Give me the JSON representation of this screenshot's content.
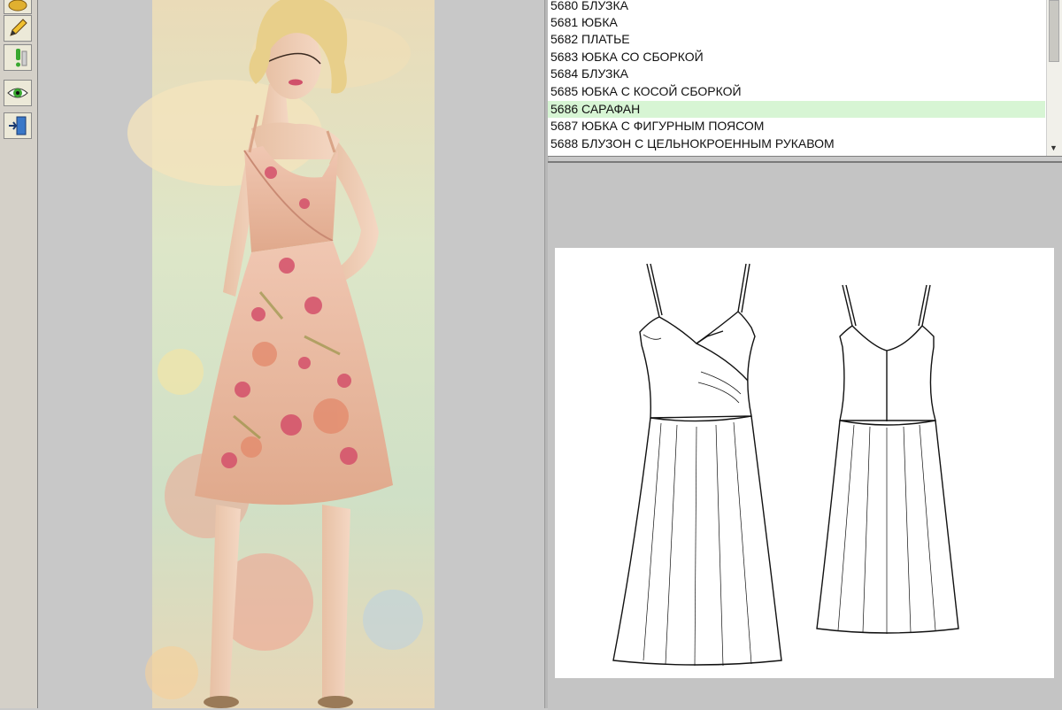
{
  "toolbar": {
    "buttons": [
      "open-icon",
      "pencil-icon",
      "info-icon",
      "eye-icon",
      "exit-icon"
    ]
  },
  "model_list": {
    "items": [
      {
        "label": "5680 БЛУЗКА",
        "selected": false
      },
      {
        "label": "5681 ЮБКА",
        "selected": false
      },
      {
        "label": "5682 ПЛАТЬЕ",
        "selected": false
      },
      {
        "label": "5683 ЮБКА СО СБОРКОЙ",
        "selected": false
      },
      {
        "label": "5684 БЛУЗКА",
        "selected": false
      },
      {
        "label": "5685 ЮБКА С КОСОЙ СБОРКОЙ",
        "selected": false
      },
      {
        "label": "5686 САРАФАН",
        "selected": true
      },
      {
        "label": "5687 ЮБКА С ФИГУРНЫМ ПОЯСОМ",
        "selected": false
      },
      {
        "label": "5688 БЛУЗОН С ЦЕЛЬНОКРОЕННЫМ РУКАВОМ",
        "selected": false
      }
    ]
  },
  "colors": {
    "selected_row": "#d7f5d4",
    "dress_base": "#e8b89a",
    "flower_accent": "#d4506a"
  }
}
